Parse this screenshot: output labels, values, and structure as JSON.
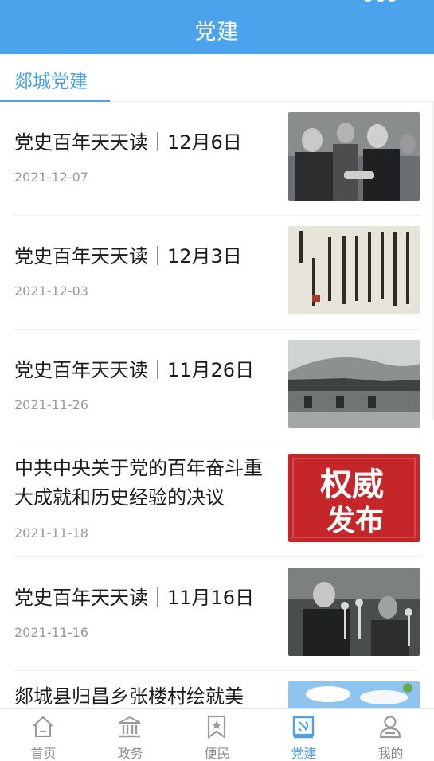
{
  "header": {
    "title": "党建"
  },
  "tabs": {
    "active_label": "郯城党建"
  },
  "articles": [
    {
      "title": "党史百年天天读｜12月6日",
      "date": "2021-12-07",
      "thumb": "photo-leaders-handshake"
    },
    {
      "title": "党史百年天天读｜12月3日",
      "date": "2021-12-03",
      "thumb": "calligraphy-inscription"
    },
    {
      "title": "党史百年天天读｜11月26日",
      "date": "2021-11-26",
      "thumb": "photo-old-farmhouse"
    },
    {
      "title": "中共中央关于党的百年奋斗重大成就和历史经验的决议",
      "date": "2021-11-18",
      "thumb": "authoritative-release-banner",
      "thumb_text_1": "权威",
      "thumb_text_2": "发布"
    },
    {
      "title": "党史百年天天读｜11月16日",
      "date": "2021-11-16",
      "thumb": "photo-speaker-microphones"
    },
    {
      "title": "郯城县归昌乡张楼村绘就美",
      "date": "",
      "thumb": "photo-blue-sky-trees"
    }
  ],
  "bottom_nav": [
    {
      "label": "首页",
      "icon": "home-icon",
      "active": false
    },
    {
      "label": "政务",
      "icon": "government-building-icon",
      "active": false
    },
    {
      "label": "便民",
      "icon": "bookmark-star-icon",
      "active": false
    },
    {
      "label": "党建",
      "icon": "party-emblem-icon",
      "active": true
    },
    {
      "label": "我的",
      "icon": "user-profile-icon",
      "active": false
    }
  ],
  "colors": {
    "accent": "#4ba3ec",
    "text": "#1b1b1b",
    "muted": "#9a9a9a",
    "nav_inactive": "#8d8d8d",
    "banner_red": "#c4262a"
  }
}
